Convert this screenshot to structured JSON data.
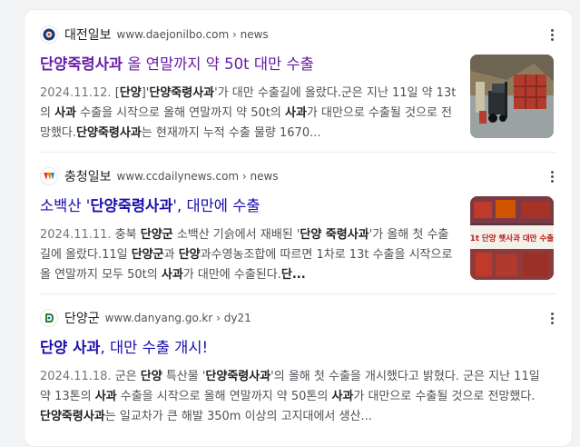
{
  "results": [
    {
      "site_name": "대전일보",
      "site_url": "www.daejonilbo.com › news",
      "favicon": "daejonilbo-favicon",
      "title_parts": [
        {
          "text": "단양죽령사과",
          "bold": true
        },
        {
          "text": " 올 연말까지 약 50t 대만 수출",
          "bold": false
        }
      ],
      "title_color": "#681da8",
      "date": "2024.11.12.",
      "snippet_parts": [
        {
          "text": " [",
          "b": false
        },
        {
          "text": "단양",
          "b": true
        },
        {
          "text": "]'",
          "b": false
        },
        {
          "text": "단양죽령사과",
          "b": true
        },
        {
          "text": "'가 대만 수출길에 올랐다.군은 지난 11일 약 13t의 ",
          "b": false
        },
        {
          "text": "사과",
          "b": true
        },
        {
          "text": " 수출을 시작으로 올해 연말까지 약 50t의 ",
          "b": false
        },
        {
          "text": "사과",
          "b": true
        },
        {
          "text": "가 대만으로 수출될 것으로 전망했다.",
          "b": false
        },
        {
          "text": "단양죽령사과",
          "b": true
        },
        {
          "text": "는 현재까지 누적 수출 물량 1670...",
          "b": false
        }
      ],
      "thumbnail": "forklift-apple-crates-photo"
    },
    {
      "site_name": "충청일보",
      "site_url": "www.ccdailynews.com › news",
      "favicon": "ccdailynews-favicon",
      "title_parts": [
        {
          "text": "소백산 '",
          "bold": false
        },
        {
          "text": "단양죽령사과",
          "bold": true
        },
        {
          "text": "', 대만에 수출",
          "bold": false
        }
      ],
      "title_color": "#1a0dab",
      "date": "2024.11.11.",
      "snippet_parts": [
        {
          "text": " 충북 ",
          "b": false
        },
        {
          "text": "단양군",
          "b": true
        },
        {
          "text": " 소백산 기슭에서 재배된 '",
          "b": false
        },
        {
          "text": "단양 죽령사과",
          "b": true
        },
        {
          "text": "'가 올해 첫 수출 길에 올랐다.11일 ",
          "b": false
        },
        {
          "text": "단양군",
          "b": true
        },
        {
          "text": "과 ",
          "b": false
        },
        {
          "text": "단양",
          "b": true
        },
        {
          "text": "과수영농조합에 따르면 1차로 13t 수출을 시작으로 올 연말까지 모두 50t의 ",
          "b": false
        },
        {
          "text": "사과",
          "b": true
        },
        {
          "text": "가 대만에 수출된다.",
          "b": false
        },
        {
          "text": "단...",
          "b": true
        }
      ],
      "thumbnail": "apple-export-banner-photo",
      "thumbnail_text": "1t 단양 햇사과 대만 수출"
    },
    {
      "site_name": "단양군",
      "site_url": "www.danyang.go.kr › dy21",
      "favicon": "danyang-favicon",
      "title_parts": [
        {
          "text": "단양 사과",
          "bold": true
        },
        {
          "text": ", 대만 수출 개시!",
          "bold": false
        }
      ],
      "title_color": "#1a0dab",
      "date": "2024.11.18.",
      "snippet_parts": [
        {
          "text": " 군은 ",
          "b": false
        },
        {
          "text": "단양",
          "b": true
        },
        {
          "text": " 특산물 '",
          "b": false
        },
        {
          "text": "단양죽령사과",
          "b": true
        },
        {
          "text": "'의 올해 첫 수출을 개시했다고 밝혔다. 군은 지난 11일 약 13톤의 ",
          "b": false
        },
        {
          "text": "사과",
          "b": true
        },
        {
          "text": " 수출을 시작으로 올해 연말까지 약 50톤의 ",
          "b": false
        },
        {
          "text": "사과",
          "b": true
        },
        {
          "text": "가 대만으로 수출될 것으로 전망했다. ",
          "b": false
        },
        {
          "text": "단양죽령사과",
          "b": true
        },
        {
          "text": "는 일교차가 큰 해발 350m 이상의 고지대에서 생산...",
          "b": false
        }
      ],
      "thumbnail": null
    }
  ],
  "icons": {
    "more": "more-vert-icon"
  },
  "colors": {
    "visited_link": "#681da8",
    "link": "#1a0dab",
    "snippet": "#4d5156",
    "date": "#70757a"
  }
}
